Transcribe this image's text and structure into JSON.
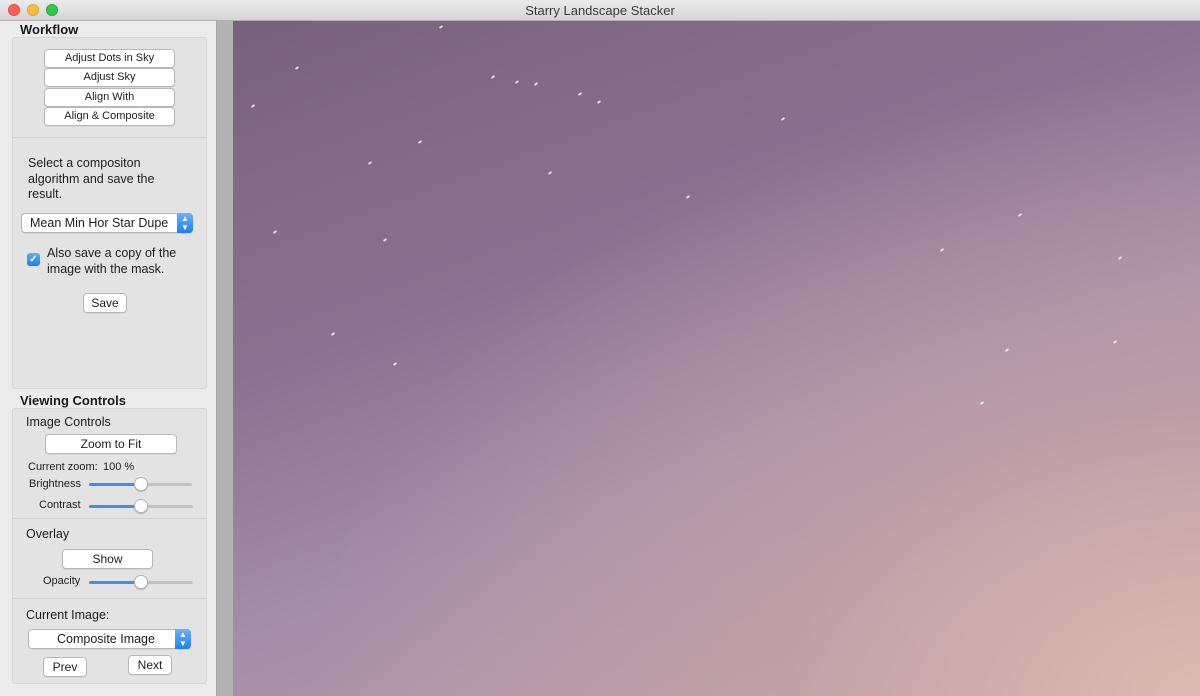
{
  "window": {
    "title": "Starry Landscape Stacker"
  },
  "workflow": {
    "title": "Workflow",
    "buttons": [
      "Adjust Dots in Sky",
      "Adjust Sky",
      "Align With",
      "Align & Composite"
    ],
    "instruction": "Select a compositon algorithm and save the result.",
    "algorithm_selected": "Mean Min Hor Star Dupe",
    "mask_checkbox_checked": true,
    "mask_checkbox_label": "Also save a copy of the image with the mask.",
    "save_label": "Save"
  },
  "viewing": {
    "title": "Viewing Controls",
    "image_controls": {
      "title": "Image Controls",
      "zoom_to_fit_label": "Zoom to Fit",
      "current_zoom_label": "Current zoom:",
      "current_zoom_value": "100 %",
      "brightness_label": "Brightness",
      "brightness_value": 0.5,
      "contrast_label": "Contrast",
      "contrast_value": 0.5
    },
    "overlay": {
      "title": "Overlay",
      "show_label": "Show",
      "opacity_label": "Opacity",
      "opacity_value": 0.5
    },
    "current_image": {
      "title": "Current Image:",
      "selected": "Composite Image",
      "prev_label": "Prev",
      "next_label": "Next"
    }
  },
  "colors": {
    "accent": "#1d7ef4",
    "sidebar_bg": "#ececec"
  },
  "icons": {
    "popup_arrows": "up-down-chevron-icon",
    "checkbox": "checkmark-icon"
  }
}
